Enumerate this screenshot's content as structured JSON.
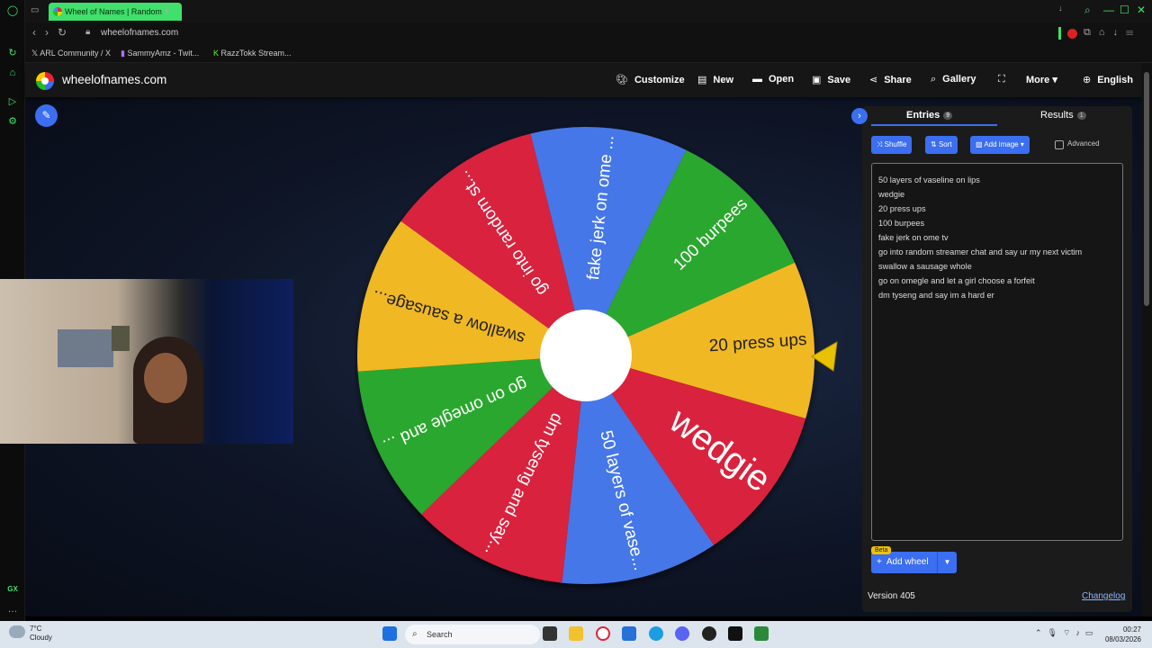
{
  "browser": {
    "tab_title": "Wheel of Names | Random",
    "new_tab": "+",
    "url": "wheelofnames.com",
    "bookmarks": [
      "ARL Community / X",
      "SammyAmz - Twit...",
      "RazzTokk Stream..."
    ]
  },
  "site": {
    "name": "wheelofnames.com",
    "menu": [
      {
        "label": "Customize",
        "icon": "palette-icon"
      },
      {
        "label": "New",
        "icon": "file-icon"
      },
      {
        "label": "Open",
        "icon": "folder-icon"
      },
      {
        "label": "Save",
        "icon": "save-icon"
      },
      {
        "label": "Share",
        "icon": "share-icon"
      },
      {
        "label": "Gallery",
        "icon": "search-icon"
      },
      {
        "label": "",
        "icon": "fullscreen-icon"
      },
      {
        "label": "More",
        "icon": "chevron-down-icon"
      },
      {
        "label": "English",
        "icon": "globe-icon"
      }
    ]
  },
  "wheel": {
    "colors": {
      "red": "#d9243d",
      "blue": "#4577e8",
      "green": "#2ba72e",
      "yellow": "#f0b823"
    },
    "selected": "20 press ups",
    "slices": [
      {
        "label": "20 press ups",
        "color": "yellow"
      },
      {
        "label": "wedgie",
        "color": "red"
      },
      {
        "label": "50 layers of vase...",
        "color": "blue"
      },
      {
        "label": "dm tyseng and say...",
        "color": "red"
      },
      {
        "label": "go on omegle and ...",
        "color": "green"
      },
      {
        "label": "swallow a sausage...",
        "color": "yellow"
      },
      {
        "label": "go into random st...",
        "color": "red"
      },
      {
        "label": "fake jerk on ome ...",
        "color": "blue"
      },
      {
        "label": "100 burpees",
        "color": "green"
      }
    ]
  },
  "panel": {
    "entries_tab": "Entries",
    "entries_count": "9",
    "results_tab": "Results",
    "results_count": "1",
    "shuffle": "Shuffle",
    "sort": "Sort",
    "add_image": "Add image",
    "advanced": "Advanced",
    "entries": [
      "50 layers of vaseline on lips",
      "wedgie",
      "20 press ups",
      "100 burpees",
      "fake jerk on ome tv",
      "go into random streamer chat and say ur my next victim",
      "swallow a sausage whole",
      "go on omegle and let a girl choose a forfeit",
      "dm tyseng and say im a hard er"
    ],
    "beta": "Beta",
    "add_wheel": "Add wheel",
    "version": "Version 405",
    "changelog": "Changelog"
  },
  "taskbar": {
    "temp": "7°C",
    "weather": "Cloudy",
    "search": "Search",
    "time": "00:27",
    "date": "08/03/2026"
  }
}
